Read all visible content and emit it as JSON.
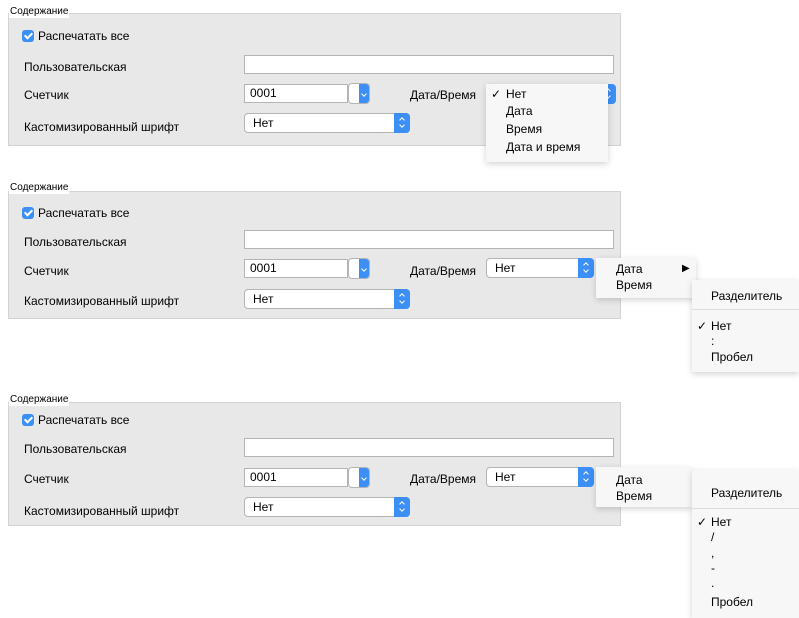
{
  "section_title": "Содержание",
  "print_all_label": "Распечатать все",
  "custom_label": "Пользовательская",
  "counter_label": "Счетчик",
  "counter_value": "0001",
  "datetime_label": "Дата/Время",
  "custom_font_label": "Кастомизированный шрифт",
  "custom_font_value": "Нет",
  "datetime_value": "Нет",
  "datetime_menu": [
    "Нет",
    "Дата",
    "Время",
    "Дата и время"
  ],
  "date_submenu": [
    "Дата",
    "Время"
  ],
  "separator_header": "Разделитель",
  "separator_time_options": [
    "Нет",
    ":",
    "Пробел"
  ],
  "separator_date_options": [
    "Нет",
    "/",
    ",",
    "-",
    ".",
    "Пробел"
  ],
  "checkmark": "✓",
  "submenu_arrow": "▶",
  "accent_color": "#3b8ff6"
}
